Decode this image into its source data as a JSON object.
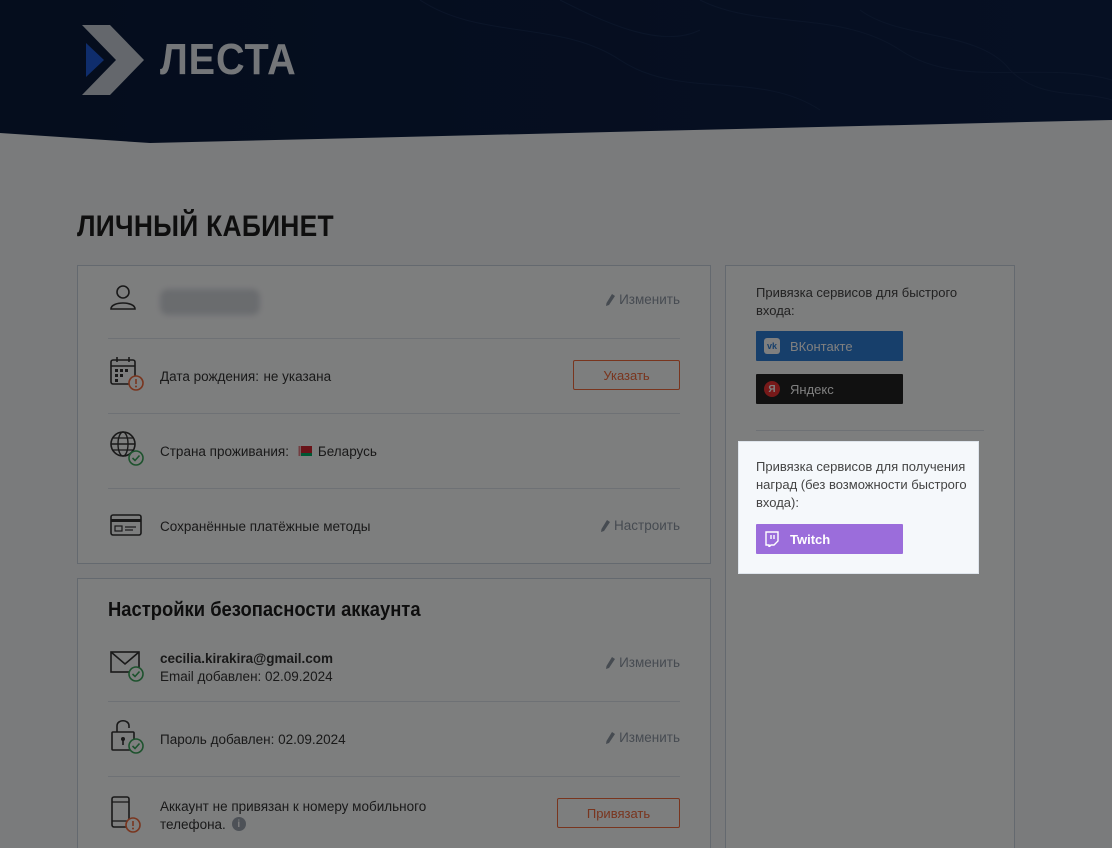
{
  "brand": {
    "logo_text": "ЛЕСТА"
  },
  "page": {
    "title": "ЛИЧНЫЙ КАБИНЕТ"
  },
  "profile": {
    "edit_label": "Изменить",
    "birthdate": {
      "label": "Дата рождения:",
      "value": "не указана",
      "button": "Указать"
    },
    "country": {
      "label": "Страна проживания:",
      "value": "Беларусь"
    },
    "payments": {
      "label": "Сохранённые платёжные методы",
      "action": "Настроить"
    }
  },
  "security": {
    "title": "Настройки безопасности аккаунта",
    "email": {
      "address": "cecilia.kirakira@gmail.com",
      "added": "Email добавлен: 02.09.2024",
      "action": "Изменить"
    },
    "password": {
      "added": "Пароль добавлен: 02.09.2024",
      "action": "Изменить"
    },
    "phone": {
      "line1": "Аккаунт не привязан к номеру мобильного",
      "line2": "телефона.",
      "button": "Привязать"
    }
  },
  "services": {
    "quick_login_text": "Привязка сервисов для быстрого входа:",
    "vk_label": "ВКонтакте",
    "yandex_label": "Яндекс",
    "rewards_text": "Привязка сервисов для получения наград (без возможности быстрого входа):",
    "twitch_label": "Twitch"
  },
  "colors": {
    "accent_orange": "#f26a3c",
    "vk_blue": "#2f7fd6",
    "twitch_purple": "#9b6ddb",
    "success_green": "#3aa55b",
    "header_navy": "#0b1b3a"
  }
}
